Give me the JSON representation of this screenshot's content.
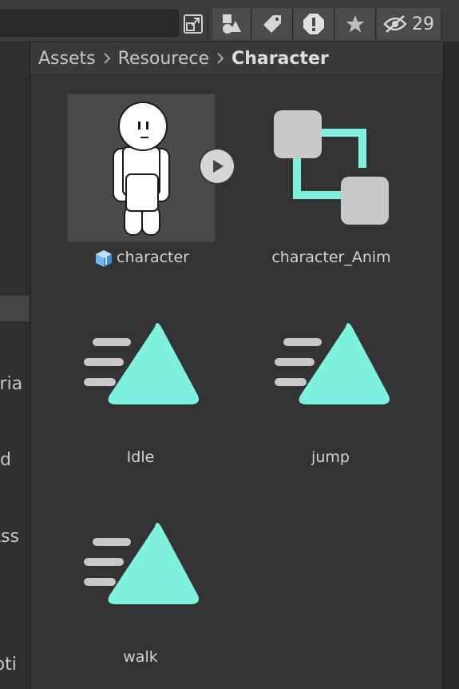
{
  "toolbar": {
    "search_value": "",
    "hidden_count": "29",
    "icons": [
      "popout-icon",
      "shapes-icon",
      "tag-icon",
      "error-icon",
      "star-icon",
      "eye-slash-icon"
    ]
  },
  "sidebar": {
    "truncated_items": [
      "eria",
      "nd",
      "Ass",
      "ipti"
    ]
  },
  "breadcrumb": {
    "items": [
      "Assets",
      "Resourece",
      "Character"
    ]
  },
  "assets": [
    {
      "name": "character",
      "type": "model"
    },
    {
      "name": "character_Anim",
      "type": "animator-controller"
    },
    {
      "name": "Idle",
      "type": "animation-clip"
    },
    {
      "name": "jump",
      "type": "animation-clip"
    },
    {
      "name": "walk",
      "type": "animation-clip"
    }
  ],
  "colors": {
    "accent": "#7ef2de",
    "panel": "#333333",
    "toolbar": "#3c3c3c"
  }
}
